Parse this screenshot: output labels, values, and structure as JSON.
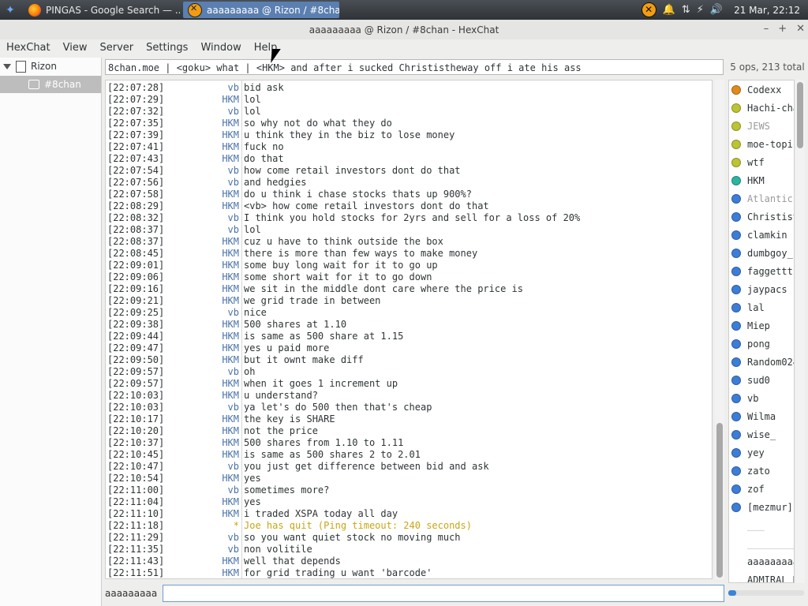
{
  "taskbar": {
    "tasks": [
      {
        "label": "PINGAS - Google Search — ...",
        "icon": "firefox-icon"
      },
      {
        "label": "aaaaaaaaa @ Rizon / #8cha...",
        "icon": "hexchat-icon"
      }
    ],
    "clock": "21 Mar, 22:12"
  },
  "window": {
    "title": "aaaaaaaaa @ Rizon / #8chan - HexChat"
  },
  "menu": [
    "HexChat",
    "View",
    "Server",
    "Settings",
    "Window",
    "Help"
  ],
  "tree": {
    "server": "Rizon",
    "channel": "#8chan"
  },
  "topic": "8chan.moe | <goku> what | <HKM> and after i sucked Christistheway off i ate his ass",
  "ops_count": "5 ops, 213 total",
  "messages": [
    {
      "ts": "[22:07:28]",
      "nick": "vb",
      "msg": "bid ask"
    },
    {
      "ts": "[22:07:29]",
      "nick": "HKM",
      "msg": "lol"
    },
    {
      "ts": "[22:07:32]",
      "nick": "vb",
      "msg": "lol"
    },
    {
      "ts": "[22:07:35]",
      "nick": "HKM",
      "msg": "so why not do what they do"
    },
    {
      "ts": "[22:07:39]",
      "nick": "HKM",
      "msg": "u think they in the biz to lose money"
    },
    {
      "ts": "[22:07:41]",
      "nick": "HKM",
      "msg": "fuck no"
    },
    {
      "ts": "[22:07:43]",
      "nick": "HKM",
      "msg": "do that"
    },
    {
      "ts": "[22:07:54]",
      "nick": "vb",
      "msg": "how come retail investors dont do that"
    },
    {
      "ts": "[22:07:56]",
      "nick": "vb",
      "msg": "and hedgies"
    },
    {
      "ts": "[22:07:58]",
      "nick": "HKM",
      "msg": "do u think i chase stocks thats up 900%?"
    },
    {
      "ts": "[22:08:29]",
      "nick": "HKM",
      "msg": "<vb> how come retail investors dont do that"
    },
    {
      "ts": "[22:08:32]",
      "nick": "vb",
      "msg": "I think you hold stocks for 2yrs and sell for a loss of 20%"
    },
    {
      "ts": "[22:08:37]",
      "nick": "vb",
      "msg": "lol"
    },
    {
      "ts": "[22:08:37]",
      "nick": "HKM",
      "msg": "cuz u have to think outside the box"
    },
    {
      "ts": "[22:08:45]",
      "nick": "HKM",
      "msg": "there is more than few ways to make money"
    },
    {
      "ts": "[22:09:01]",
      "nick": "HKM",
      "msg": "some buy long wait for it to go up"
    },
    {
      "ts": "[22:09:06]",
      "nick": "HKM",
      "msg": "some short wait for it to go down"
    },
    {
      "ts": "[22:09:16]",
      "nick": "HKM",
      "msg": "we sit in the middle dont care where the price is"
    },
    {
      "ts": "[22:09:21]",
      "nick": "HKM",
      "msg": "we grid trade in between"
    },
    {
      "ts": "[22:09:25]",
      "nick": "vb",
      "msg": "nice"
    },
    {
      "ts": "[22:09:38]",
      "nick": "HKM",
      "msg": "500 shares at 1.10"
    },
    {
      "ts": "[22:09:44]",
      "nick": "HKM",
      "msg": "is same as 500 share at 1.15"
    },
    {
      "ts": "[22:09:47]",
      "nick": "HKM",
      "msg": "yes u paid more"
    },
    {
      "ts": "[22:09:50]",
      "nick": "HKM",
      "msg": "but it ownt make diff"
    },
    {
      "ts": "[22:09:57]",
      "nick": "vb",
      "msg": "oh"
    },
    {
      "ts": "[22:09:57]",
      "nick": "HKM",
      "msg": "when it goes 1 increment up"
    },
    {
      "ts": "[22:10:03]",
      "nick": "HKM",
      "msg": "u understand?"
    },
    {
      "ts": "[22:10:03]",
      "nick": "vb",
      "msg": "ya let's do 500 then that's cheap"
    },
    {
      "ts": "[22:10:17]",
      "nick": "HKM",
      "msg": "the key is SHARE"
    },
    {
      "ts": "[22:10:20]",
      "nick": "HKM",
      "msg": "not the price"
    },
    {
      "ts": "[22:10:37]",
      "nick": "HKM",
      "msg": "500 shares from 1.10 to 1.11"
    },
    {
      "ts": "[22:10:45]",
      "nick": "HKM",
      "msg": "is same as 500 shares 2 to 2.01"
    },
    {
      "ts": "[22:10:47]",
      "nick": "vb",
      "msg": "you just get difference between bid and ask"
    },
    {
      "ts": "[22:10:54]",
      "nick": "HKM",
      "msg": "yes"
    },
    {
      "ts": "[22:11:00]",
      "nick": "vb",
      "msg": "sometimes more?"
    },
    {
      "ts": "[22:11:04]",
      "nick": "HKM",
      "msg": "yes"
    },
    {
      "ts": "[22:11:10]",
      "nick": "HKM",
      "msg": "i traded XSPA today all day"
    },
    {
      "ts": "[22:11:18]",
      "nick": "*",
      "msg": "Joe has quit (Ping timeout: 240 seconds)",
      "system": true
    },
    {
      "ts": "[22:11:29]",
      "nick": "vb",
      "msg": "so you want quiet stock no moving much"
    },
    {
      "ts": "[22:11:35]",
      "nick": "vb",
      "msg": "non volitile"
    },
    {
      "ts": "[22:11:43]",
      "nick": "HKM",
      "msg": "well that depends"
    },
    {
      "ts": "[22:11:51]",
      "nick": "HKM",
      "msg": "for grid trading u want 'barcode'"
    }
  ],
  "users": [
    {
      "name": "Codexx",
      "color": "#e08a1e"
    },
    {
      "name": "Hachi-chan",
      "color": "#bcc434"
    },
    {
      "name": "JEWS",
      "color": "#bcc434",
      "away": true
    },
    {
      "name": "moe-topic",
      "color": "#bcc434"
    },
    {
      "name": "wtf",
      "color": "#bcc434"
    },
    {
      "name": "HKM",
      "color": "#2bb5a0"
    },
    {
      "name": "Atlantic",
      "color": "#3c7dd8",
      "away": true
    },
    {
      "name": "Christistheway",
      "color": "#3c7dd8"
    },
    {
      "name": "clamkin",
      "color": "#3c7dd8"
    },
    {
      "name": "dumbgoy_",
      "color": "#3c7dd8"
    },
    {
      "name": "faggetttsss",
      "color": "#3c7dd8"
    },
    {
      "name": "jaypacs",
      "color": "#3c7dd8"
    },
    {
      "name": "lal",
      "color": "#3c7dd8"
    },
    {
      "name": "Miep",
      "color": "#3c7dd8"
    },
    {
      "name": "pong",
      "color": "#3c7dd8"
    },
    {
      "name": "Random024",
      "color": "#3c7dd8"
    },
    {
      "name": "sud0",
      "color": "#3c7dd8"
    },
    {
      "name": "vb",
      "color": "#3c7dd8"
    },
    {
      "name": "Wilma",
      "color": "#3c7dd8"
    },
    {
      "name": "wise_",
      "color": "#3c7dd8"
    },
    {
      "name": "yey",
      "color": "#3c7dd8"
    },
    {
      "name": "zato",
      "color": "#3c7dd8"
    },
    {
      "name": "zof",
      "color": "#3c7dd8"
    },
    {
      "name": "[mezmur]",
      "color": "#3c7dd8"
    },
    {
      "name": "___",
      "color": "",
      "sep": true
    },
    {
      "name": "__________",
      "color": "",
      "sep": true
    },
    {
      "name": "aaaaaaaaa",
      "color": "",
      "plain": true
    },
    {
      "name": "ADMIRAL_H",
      "color": "",
      "plain": true
    }
  ],
  "input": {
    "nick": "aaaaaaaaa",
    "value": ""
  }
}
